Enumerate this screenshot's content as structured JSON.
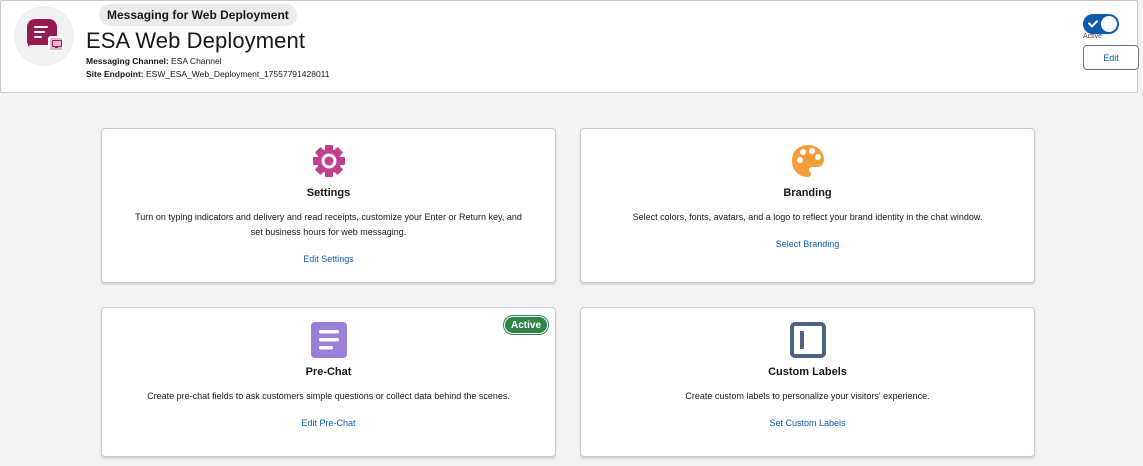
{
  "header": {
    "type_label": "Messaging for Web Deployment",
    "title": "ESA Web Deployment",
    "channel_label": "Messaging Channel",
    "channel_value": "ESA Channel",
    "endpoint_label": "Site Endpoint",
    "endpoint_value": "ESW_ESA_Web_Deployment_17557791428011",
    "toggle_on": true,
    "toggle_label": "Active",
    "edit_label": "Edit"
  },
  "cards": [
    {
      "title": "Settings",
      "description": "Turn on typing indicators and delivery and read receipts, customize your Enter or Return key, and set business hours for web messaging.",
      "link": "Edit Settings",
      "icon": "gear-icon",
      "icon_color": "#c23f90"
    },
    {
      "title": "Branding",
      "description": "Select colors, fonts, avatars, and a logo to reflect your brand identity in the chat window.",
      "link": "Select Branding",
      "icon": "palette-icon",
      "icon_color": "#f49d3b"
    },
    {
      "title": "Pre-Chat",
      "description": "Create pre-chat fields to ask customers simple questions or collect data behind the scenes.",
      "link": "Edit Pre-Chat",
      "icon": "form-icon",
      "icon_color": "#9b7ed8",
      "badge": "Active"
    },
    {
      "title": "Custom Labels",
      "description": "Create custom labels to personalize your visitors' experience.",
      "link": "Set Custom Labels",
      "icon": "label-frame-icon",
      "icon_color": "#4c6486"
    }
  ],
  "colors": {
    "brand_blue": "#0b5cab",
    "app_icon": "#951a53",
    "active_badge": "#2e844a"
  }
}
